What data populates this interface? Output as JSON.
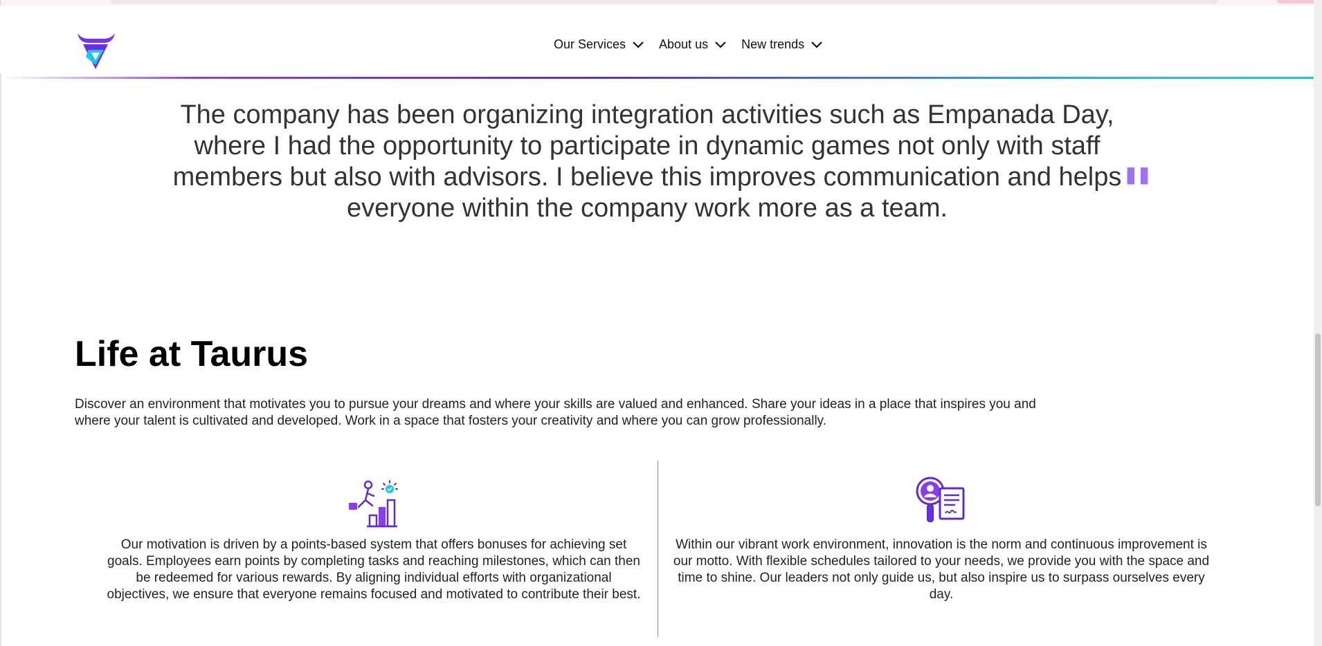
{
  "header": {
    "nav": [
      {
        "label": "Our Services"
      },
      {
        "label": "About us"
      },
      {
        "label": "New trends"
      }
    ]
  },
  "testimonial": {
    "quote": "The company has been organizing integration activities such as Empanada Day, where I had the opportunity to participate in dynamic games not only with staff members but also with advisors. I believe this improves communication and helps everyone within the company work more as a team.",
    "mark": "\""
  },
  "life": {
    "title": "Life at Taurus",
    "intro": "Discover an environment that motivates you to pursue your dreams and where your skills are valued and enhanced. Share your ideas in a place that inspires you and where your talent is cultivated and developed. Work in a space that fosters your creativity and where you can grow professionally.",
    "cards": [
      {
        "icon": "growth-chart-icon",
        "text": "Our motivation is driven by a points-based system that offers bonuses for achieving set goals. Employees earn points by completing tasks and reaching milestones, which can then be redeemed for various rewards. By aligning individual efforts with organizational objectives, we ensure that everyone remains focused and motivated to contribute their best."
      },
      {
        "icon": "talent-search-icon",
        "text": "Within our vibrant work environment, innovation is the norm and continuous improvement is our motto. With flexible schedules tailored to your needs, we provide you with the space and time to shine. Our leaders not only guide us, but also inspire us to surpass ourselves every day."
      }
    ]
  },
  "colors": {
    "accent": "#7b2ff7",
    "accent_light": "#9b73f0",
    "cyan": "#1ac6f4"
  }
}
